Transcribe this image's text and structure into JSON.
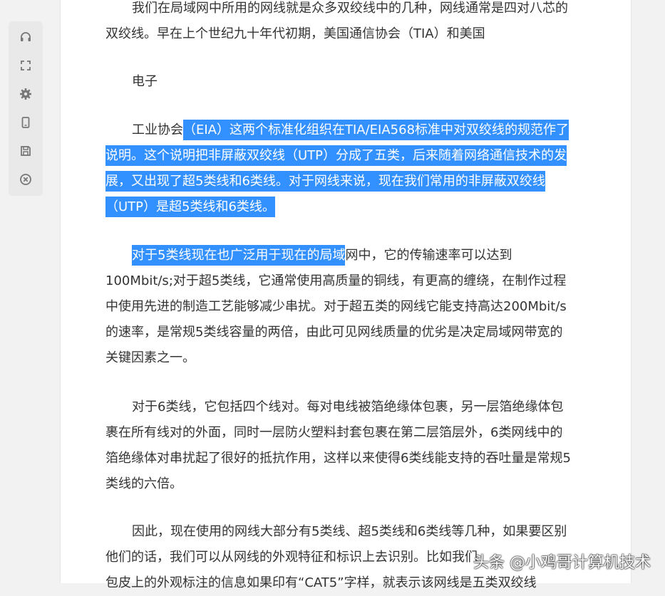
{
  "toolbar": {
    "buttons": [
      {
        "name": "headphones-icon"
      },
      {
        "name": "fullscreen-icon"
      },
      {
        "name": "gear-icon"
      },
      {
        "name": "phone-icon"
      },
      {
        "name": "save-icon"
      },
      {
        "name": "close-circle-icon"
      }
    ]
  },
  "article": {
    "p1": {
      "l1": "我们在局域网中所用的网线就是众多双绞线中的几种，网线通常是四对八芯的",
      "l2": "双绞线。早在上个世纪九十年代初期，美国通信协会（TIA）和美国"
    },
    "p2": {
      "l1": "电子"
    },
    "p3": {
      "l1_plain": "工业协会",
      "l1_sel": "（EIA）这两个标准化组织在TIA/EIA568标准中对双绞线的规范作了",
      "l2": "说明。这个说明把非屏蔽双绞线（UTP）分成了五类，后来随着网络通信技术的发",
      "l3": "展，又出现了超5类线和6类线。对于网线来说，现在我们常用的非屏蔽双绞线",
      "l4": "（UTP）是超5类线和6类线。"
    },
    "p4": {
      "l1_sel": "对于5类线现在也广泛用于现在的局域",
      "l1_plain": "网中，它的传输速率可以达到",
      "l2": "100Mbit/s;对于超5类线，它通常使用高质量的铜线，有更高的缠绕，在制作过程",
      "l3": "中使用先进的制造工艺能够减少串扰。对于超五类的网线它能支持高达200Mbit/s",
      "l4": "的速率，是常规5类线容量的两倍，由此可见网线质量的优劣是决定局域网带宽的",
      "l5": "关键因素之一。"
    },
    "p5": {
      "l1": "对于6类线，它包括四个线对。每对电线被箔绝缘体包裹，另一层箔绝缘体包",
      "l2": "裹在所有线对的外面，同时一层防火塑料封套包裹在第二层箔层外，6类网线中的",
      "l3": "箔绝缘体对串扰起了很好的抵抗作用，这样以来使得6类线能支持的吞吐量是常规5",
      "l4": "类线的六倍。"
    },
    "p6": {
      "l1": "因此，现在使用的网线大部分有5类线、超5类线和6类线等几种，如果要区别",
      "l2": "他们的话，我们可以从网线的外观特征和标识上去识别。比如我们",
      "l3": "包皮上的外观标注的信息如果印有“CAT5”字样，就表示该网线是五类双绞线"
    }
  },
  "watermark": "头条 @小鸡哥计算机技术",
  "colors": {
    "selection": "#3390ff",
    "text": "#333333",
    "background": "#f2f2f2"
  }
}
